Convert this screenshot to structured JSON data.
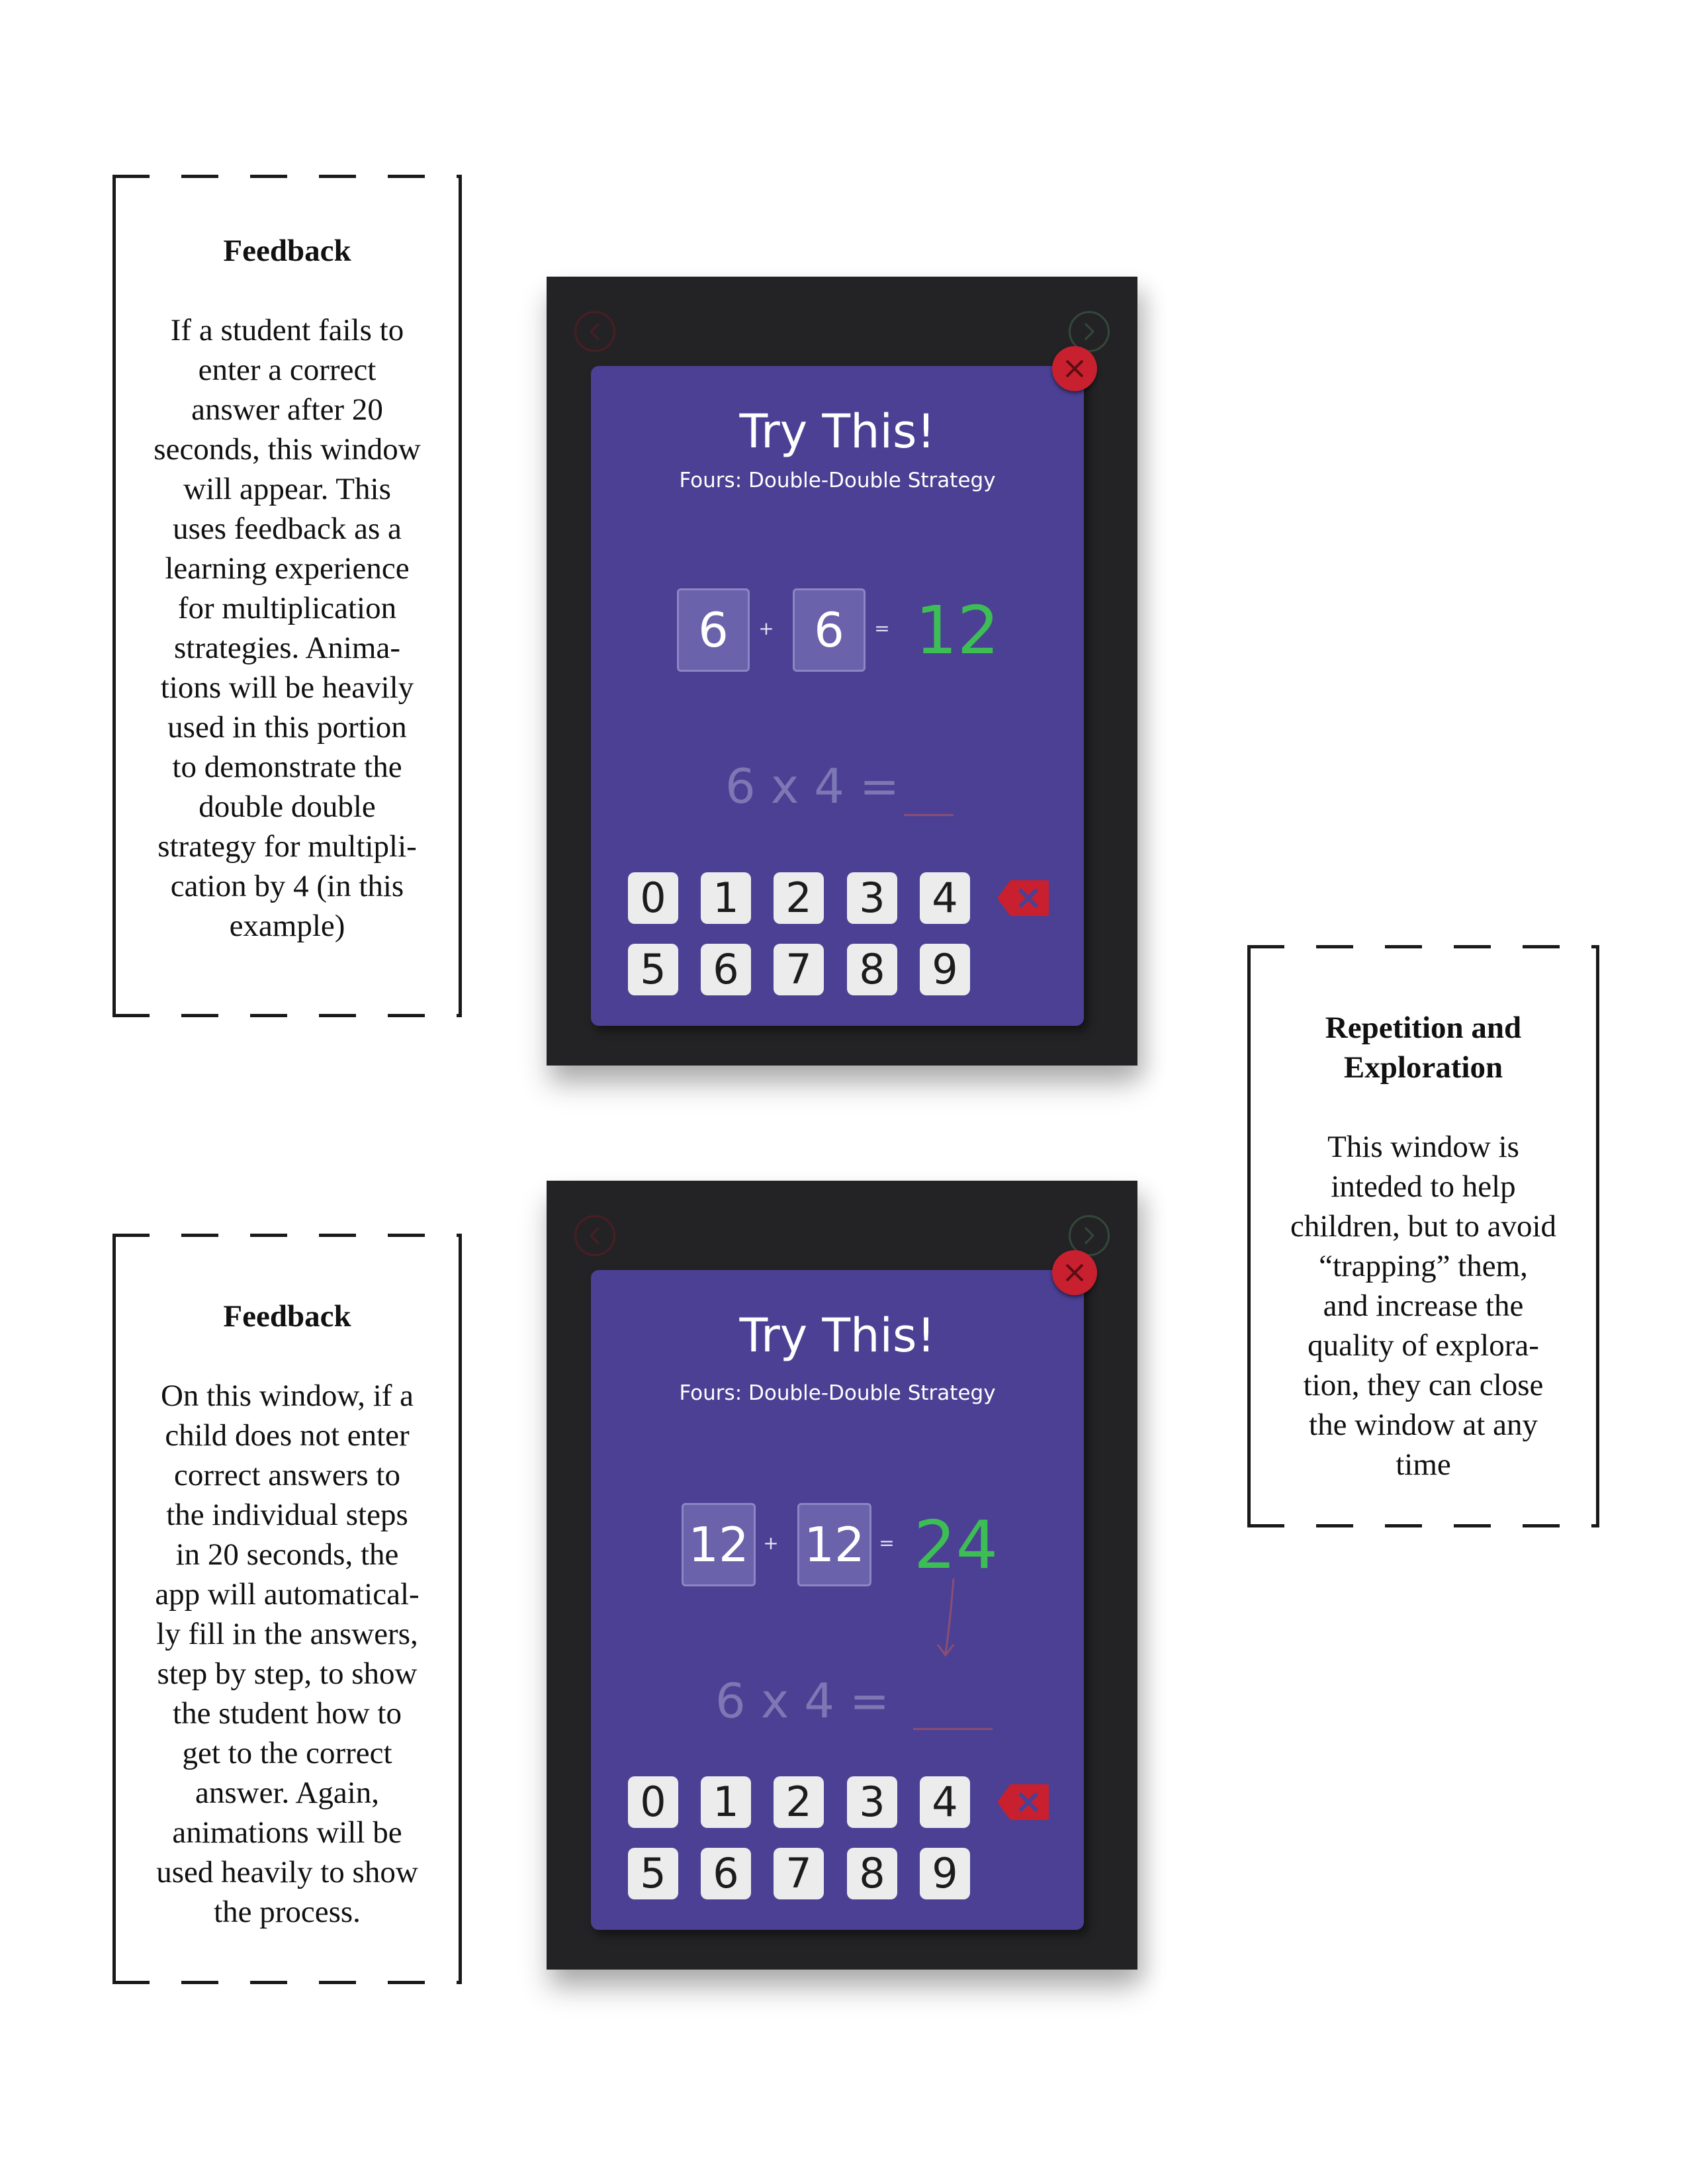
{
  "notes": [
    {
      "title": "Feedback",
      "body": "If a student fails to\nenter a correct\nanswer after 20\nseconds, this window\nwill appear. This\nuses feedback as a\nlearning experience\nfor multiplication\nstrategies. Anima-\ntions will be heavily\nused in this portion\nto demonstrate the\ndouble double\nstrategy for multipli-\ncation by 4 (in this\nexample)"
    },
    {
      "title": "Repetition and\nExploration",
      "body": "This window is\ninteded to help\nchildren, but to avoid\n“trapping” them,\nand increase the\nquality of explora-\ntion, they can close\nthe window at any\ntime"
    },
    {
      "title": "Feedback",
      "body": "On this window, if a\nchild does not enter\ncorrect answers to\nthe individual steps\nin 20 seconds, the\napp will automatical-\nly fill in the answers,\nstep by step, to show\nthe student how to\nget to the correct\nanswer. Again,\nanimations will be\nused heavily to show\nthe process."
    }
  ],
  "screens": [
    {
      "title": "Try This!",
      "subtitle": "Fours: Double-Double Strategy",
      "step": {
        "a": "6",
        "plus": "+",
        "b": "6",
        "equals": "=",
        "result": "12"
      },
      "problem": "6 x 4 =",
      "answer": "",
      "keypad": [
        "0",
        "1",
        "2",
        "3",
        "4",
        "5",
        "6",
        "7",
        "8",
        "9"
      ]
    },
    {
      "title": "Try This!",
      "subtitle": "Fours: Double-Double Strategy",
      "step": {
        "a": "12",
        "plus": "+",
        "b": "12",
        "equals": "=",
        "result": "24"
      },
      "problem": "6 x 4 =",
      "answer": "",
      "keypad": [
        "0",
        "1",
        "2",
        "3",
        "4",
        "5",
        "6",
        "7",
        "8",
        "9"
      ]
    }
  ],
  "icons": {
    "prev": "chevron-left-icon",
    "next": "chevron-right-icon",
    "close": "close-icon",
    "backspace": "backspace-icon"
  },
  "colors": {
    "card": "#4b4094",
    "device": "#232325",
    "result_green": "#3dbe55",
    "close_red": "#c8202e",
    "key_bg": "#ececec"
  }
}
